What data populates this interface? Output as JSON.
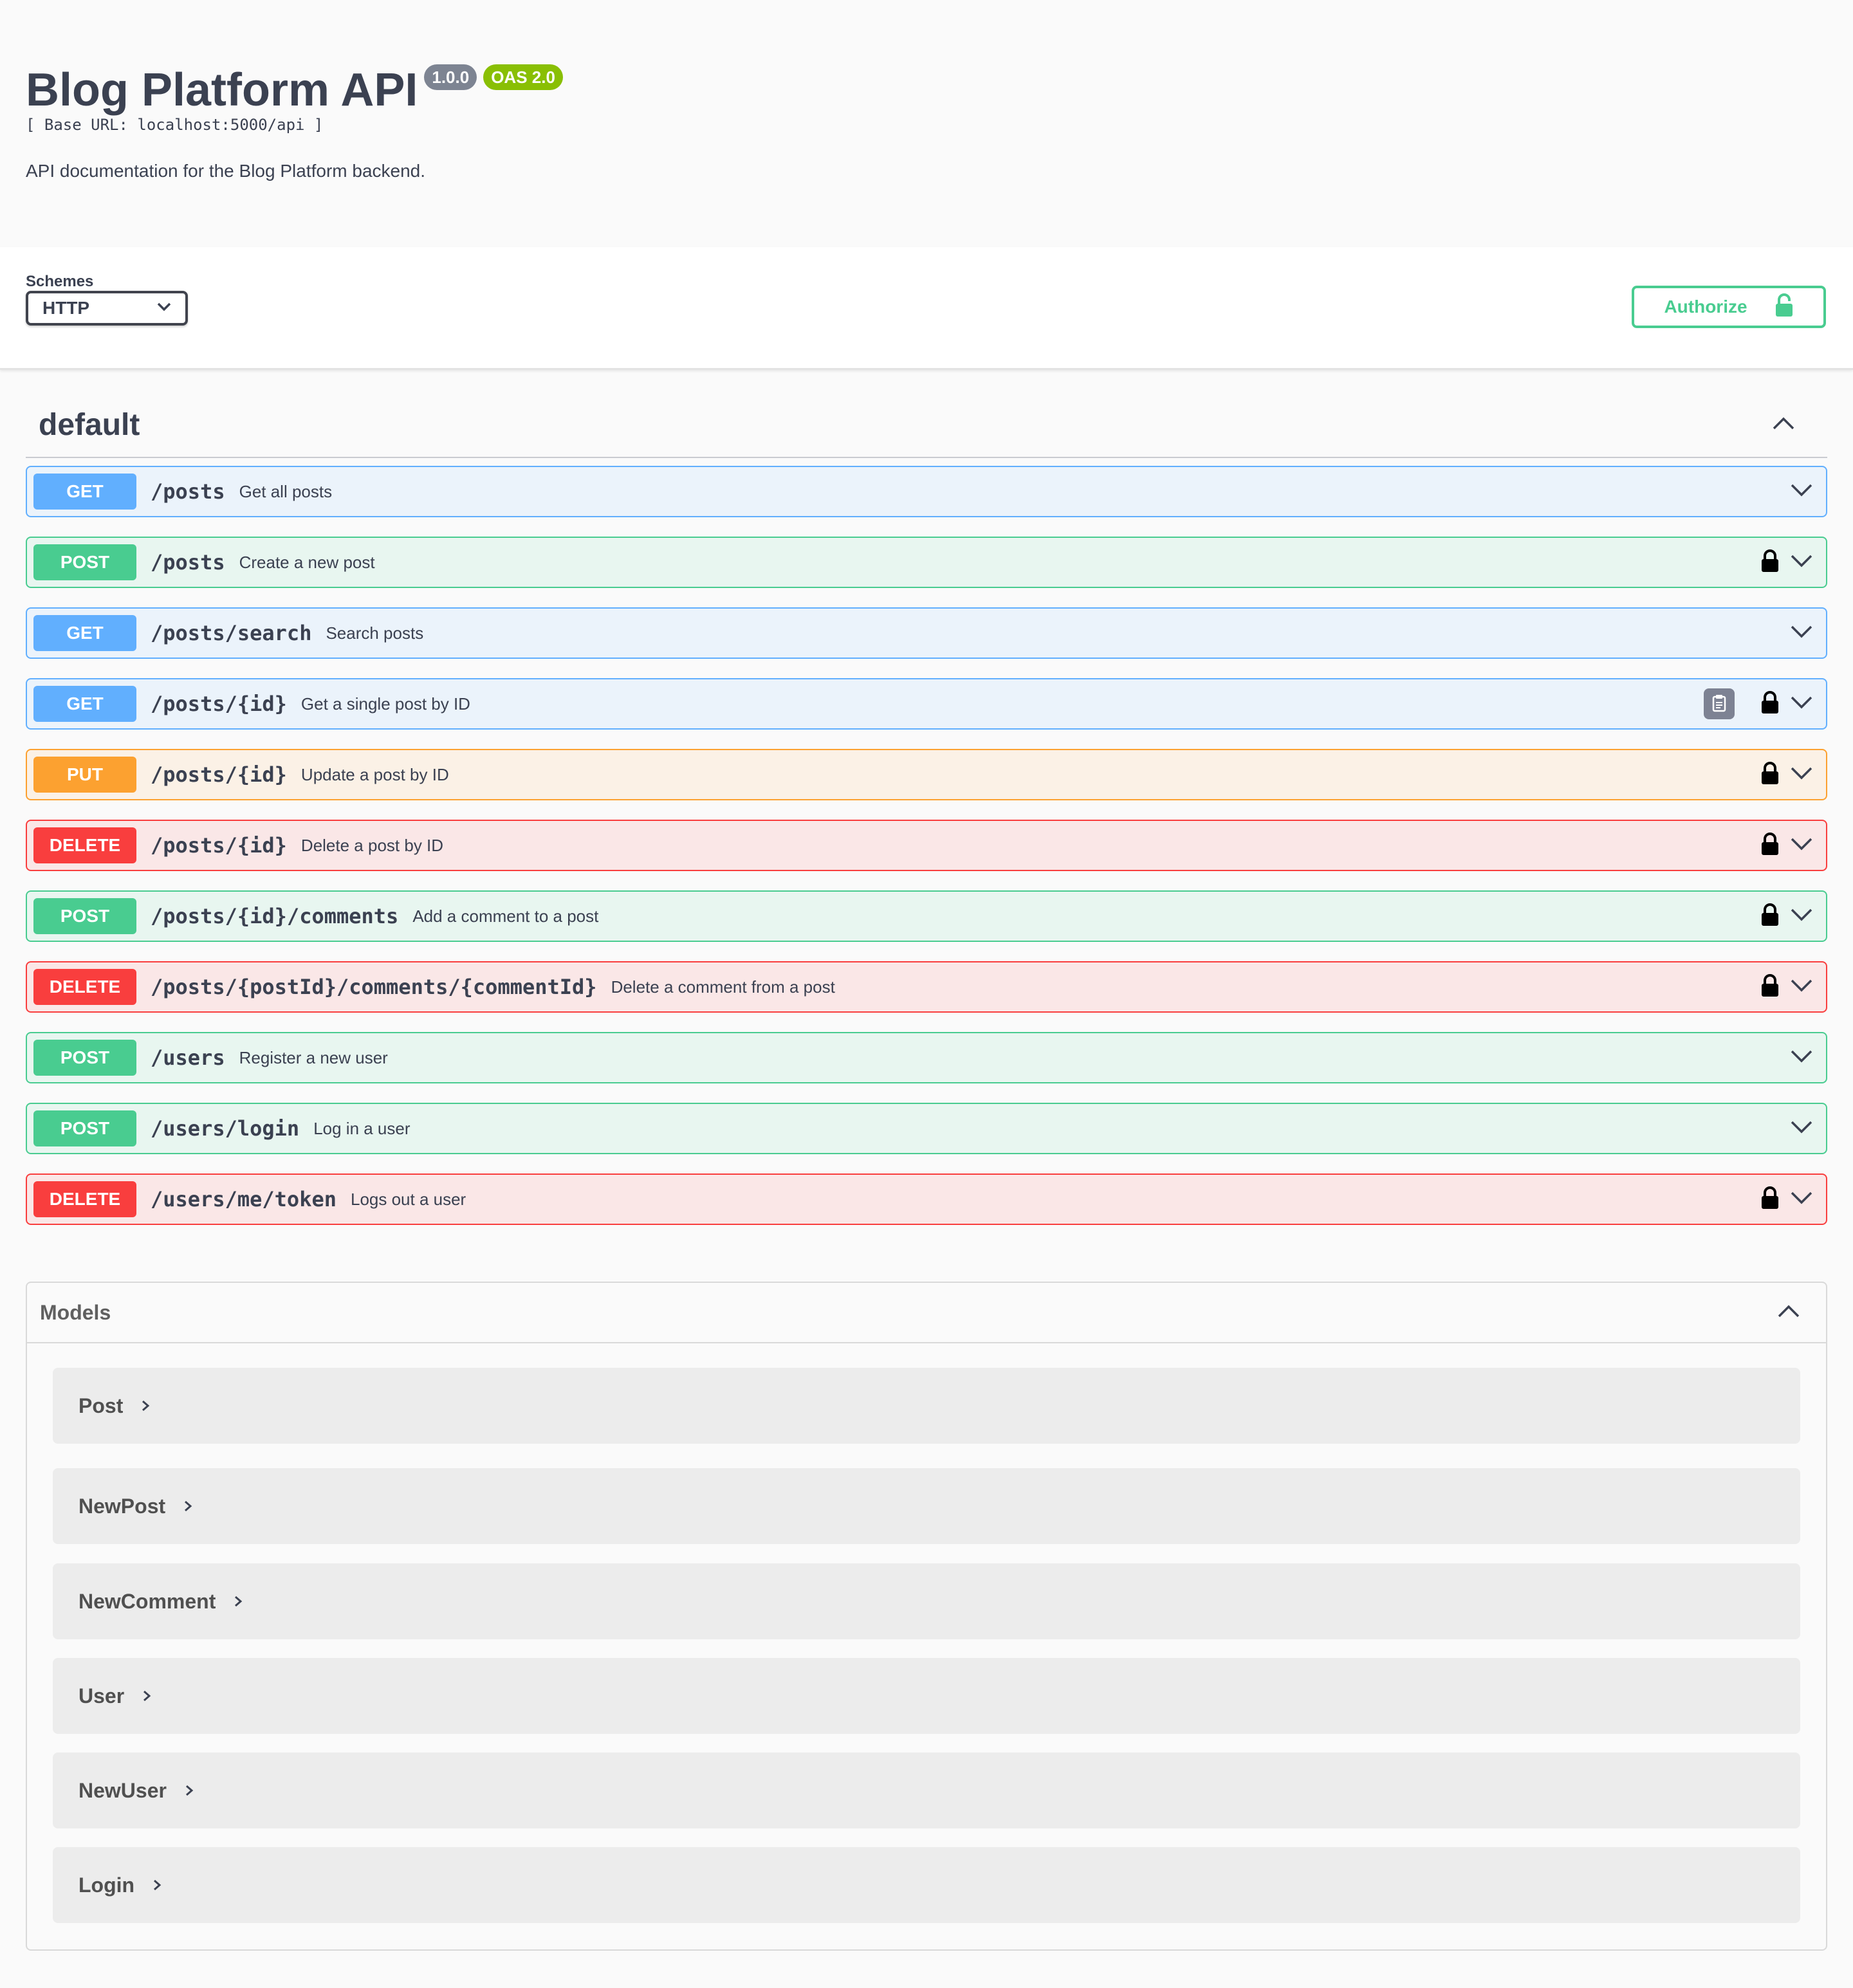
{
  "info": {
    "title": "Blog Platform API",
    "version_badge": "1.0.0",
    "oas_badge": "OAS 2.0",
    "base_url": "[ Base URL: localhost:5000/api ]",
    "description": "API documentation for the Blog Platform backend."
  },
  "schemes": {
    "label": "Schemes",
    "selected": "HTTP"
  },
  "authorize": {
    "label": "Authorize",
    "icon": "unlock-icon",
    "color": "#49cc90"
  },
  "tag": {
    "name": "default",
    "expanded": true
  },
  "method_colors": {
    "GET": "#61affe",
    "POST": "#49cc90",
    "PUT": "#fca130",
    "DELETE": "#f93e3e"
  },
  "operations": [
    {
      "method": "GET",
      "path": "/posts",
      "summary": "Get all posts",
      "locked": false,
      "copy": false
    },
    {
      "method": "POST",
      "path": "/posts",
      "summary": "Create a new post",
      "locked": true,
      "copy": false
    },
    {
      "method": "GET",
      "path": "/posts/search",
      "summary": "Search posts",
      "locked": false,
      "copy": false
    },
    {
      "method": "GET",
      "path": "/posts/{id}",
      "summary": "Get a single post by ID",
      "locked": true,
      "copy": true
    },
    {
      "method": "PUT",
      "path": "/posts/{id}",
      "summary": "Update a post by ID",
      "locked": true,
      "copy": false
    },
    {
      "method": "DELETE",
      "path": "/posts/{id}",
      "summary": "Delete a post by ID",
      "locked": true,
      "copy": false
    },
    {
      "method": "POST",
      "path": "/posts/{id}/comments",
      "summary": "Add a comment to a post",
      "locked": true,
      "copy": false
    },
    {
      "method": "DELETE",
      "path": "/posts/{postId}/comments/{commentId}",
      "summary": "Delete a comment from a post",
      "locked": true,
      "copy": false
    },
    {
      "method": "POST",
      "path": "/users",
      "summary": "Register a new user",
      "locked": false,
      "copy": false
    },
    {
      "method": "POST",
      "path": "/users/login",
      "summary": "Log in a user",
      "locked": false,
      "copy": false
    },
    {
      "method": "DELETE",
      "path": "/users/me/token",
      "summary": "Logs out a user",
      "locked": true,
      "copy": false
    }
  ],
  "models": {
    "title": "Models",
    "expanded": true,
    "items": [
      "Post",
      "NewPost",
      "NewComment",
      "User",
      "NewUser",
      "Login"
    ]
  }
}
